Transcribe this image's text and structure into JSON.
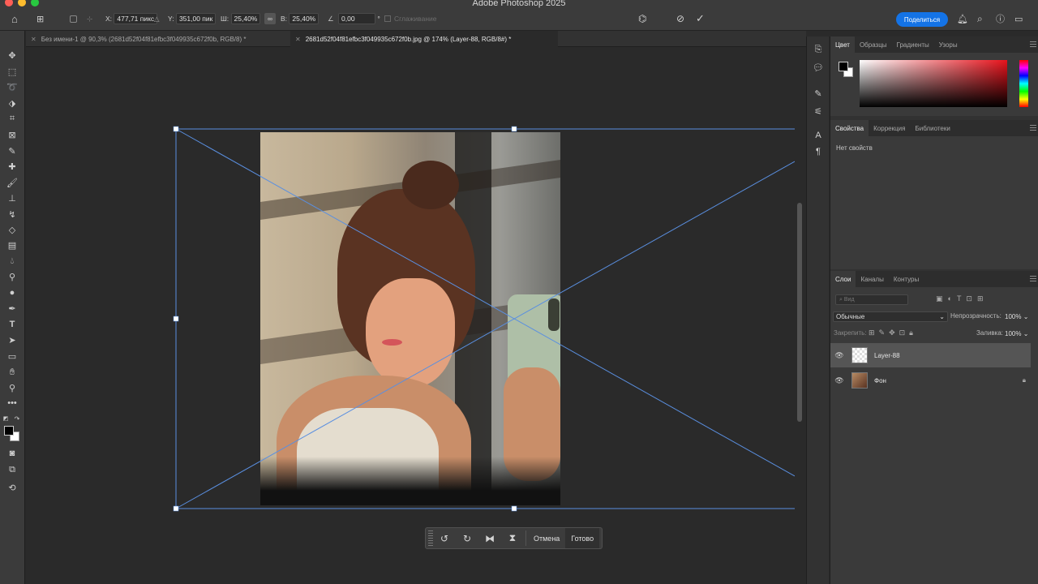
{
  "app": {
    "title": "Adobe Photoshop 2025"
  },
  "options": {
    "x_label": "X:",
    "x_value": "477,71 пикс",
    "y_label": "Y:",
    "y_value": "351,00 пик",
    "w_label": "Ш:",
    "w_value": "25,40%",
    "h_label": "В:",
    "h_value": "25,40%",
    "angle_value": "0,00",
    "angle_unit": "°",
    "smoothing_label": "Сглаживание"
  },
  "header": {
    "share_label": "Поделиться"
  },
  "tabs": [
    {
      "label": "Без имени-1 @ 90,3% (2681d52f04f81efbc3f049935c672f0b, RGB/8) *"
    },
    {
      "label": "2681d52f04f81efbc3f049935c672f0b.jpg @ 174% (Layer-88, RGB/8#) *"
    }
  ],
  "transform_bar": {
    "cancel_label": "Отмена",
    "done_label": "Готово"
  },
  "color_panel": {
    "tabs": [
      "Цвет",
      "Образцы",
      "Градиенты",
      "Узоры"
    ]
  },
  "properties_panel": {
    "tabs": [
      "Свойства",
      "Коррекция",
      "Библиотеки"
    ],
    "empty_text": "Нет свойств"
  },
  "layers_panel": {
    "tabs": [
      "Слои",
      "Каналы",
      "Контуры"
    ],
    "search_placeholder": "Вид",
    "blend_mode": "Обычные",
    "opacity_label": "Непрозрачность:",
    "opacity_value": "100%",
    "lock_label": "Закрепить:",
    "fill_label": "Заливка:",
    "fill_value": "100%",
    "layers": [
      {
        "name": "Layer-88"
      },
      {
        "name": "Фон"
      }
    ]
  },
  "colors": {
    "accent": "#1473e6",
    "transform_line": "#5a8fe0"
  }
}
